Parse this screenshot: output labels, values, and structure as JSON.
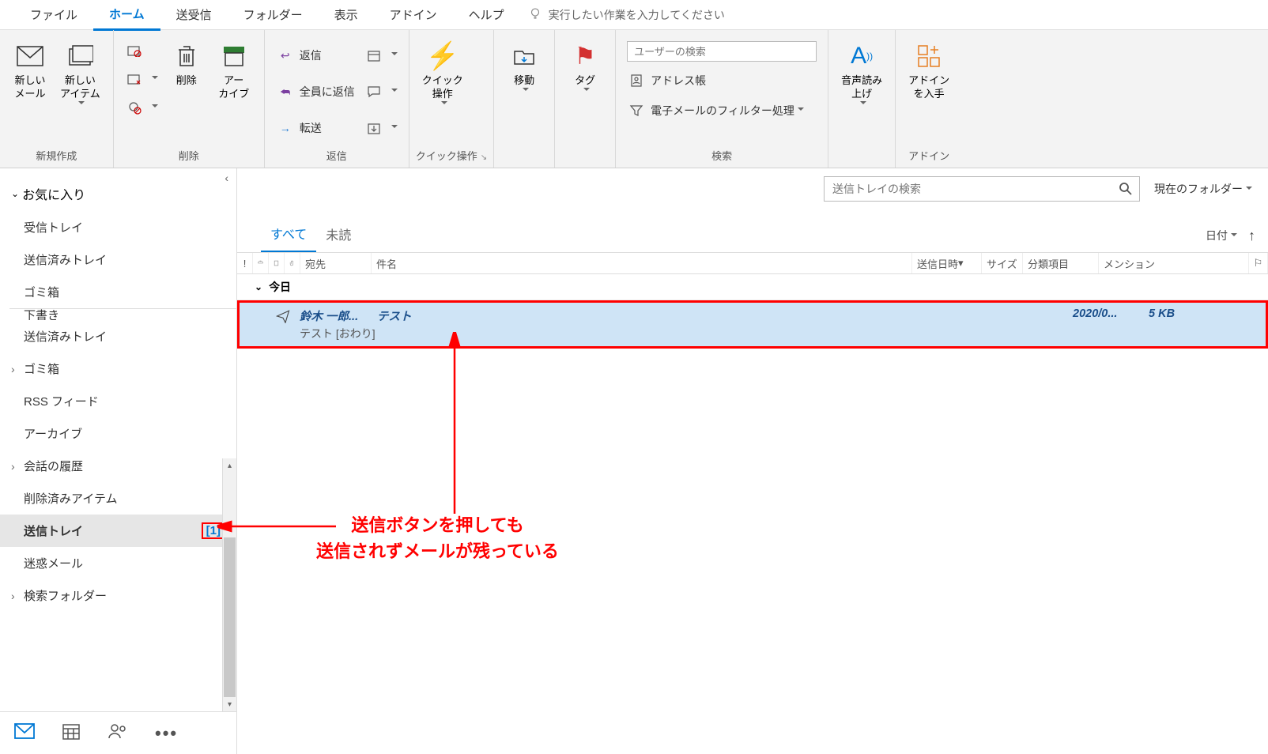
{
  "menu": {
    "items": [
      "ファイル",
      "ホーム",
      "送受信",
      "フォルダー",
      "表示",
      "アドイン",
      "ヘルプ"
    ],
    "active_index": 1,
    "tell_me": "実行したい作業を入力してください"
  },
  "ribbon": {
    "new_group": {
      "new_mail": "新しい\nメール",
      "new_item": "新しい\nアイテム",
      "label": "新規作成"
    },
    "delete_group": {
      "delete": "削除",
      "archive": "アー\nカイブ",
      "label": "削除"
    },
    "reply_group": {
      "reply": "返信",
      "reply_all": "全員に返信",
      "forward": "転送",
      "label": "返信"
    },
    "quick_group": {
      "quick": "クイック\n操作",
      "label": "クイック操作"
    },
    "move_group": {
      "move": "移動"
    },
    "tag_group": {
      "tag": "タグ"
    },
    "search_group": {
      "user_search_ph": "ユーザーの検索",
      "address": "アドレス帳",
      "filter": "電子メールのフィルター処理",
      "label": "検索"
    },
    "voice_group": {
      "voice": "音声読み\n上げ"
    },
    "addin_group": {
      "addin": "アドイン\nを入手",
      "label": "アドイン"
    }
  },
  "sidebar": {
    "favorites": "お気に入り",
    "fav_items": [
      "受信トレイ",
      "送信済みトレイ",
      "ゴミ箱"
    ],
    "folders": [
      {
        "label": "下書き",
        "exp": false,
        "clipped": true
      },
      {
        "label": "送信済みトレイ",
        "exp": false
      },
      {
        "label": "ゴミ箱",
        "exp": true
      },
      {
        "label": "RSS フィード",
        "exp": false
      },
      {
        "label": "アーカイブ",
        "exp": false
      },
      {
        "label": "会話の履歴",
        "exp": true
      },
      {
        "label": "削除済みアイテム",
        "exp": false
      },
      {
        "label": "送信トレイ",
        "exp": false,
        "selected": true,
        "count": "[1]"
      },
      {
        "label": "迷惑メール",
        "exp": false
      },
      {
        "label": "検索フォルダー",
        "exp": true
      }
    ]
  },
  "content": {
    "search_ph": "送信トレイの検索",
    "scope": "現在のフォルダー",
    "tabs": {
      "all": "すべて",
      "unread": "未読"
    },
    "sort_by": "日付",
    "columns": {
      "to": "宛先",
      "subject": "件名",
      "date": "送信日時",
      "size": "サイズ",
      "category": "分類項目",
      "mention": "メンション"
    },
    "group_today": "今日",
    "message": {
      "to": "鈴木 一郎...",
      "subject": "テスト",
      "preview": "テスト [おわり]",
      "date": "2020/0...",
      "size": "5 KB"
    }
  },
  "annotation": {
    "line1": "送信ボタンを押しても",
    "line2": "送信されずメールが残っている"
  }
}
